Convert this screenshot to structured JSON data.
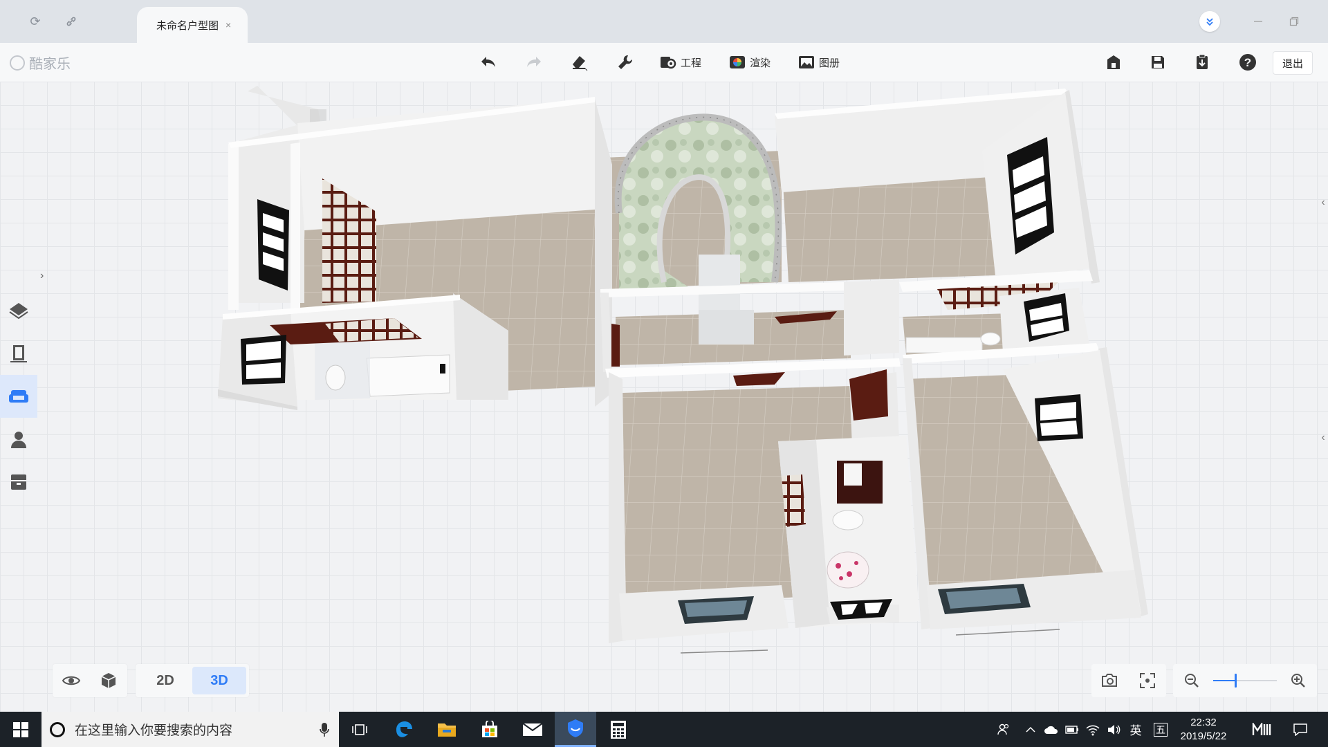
{
  "tabbar": {
    "tab_label": "未命名户型图",
    "tab_close": "×"
  },
  "toolbar": {
    "brand": "酷家乐",
    "project_label": "工程",
    "render_label": "渲染",
    "album_label": "图册",
    "exit_label": "退出"
  },
  "view": {
    "mode_2d": "2D",
    "mode_3d": "3D",
    "active_mode": "3D"
  },
  "zoom": {
    "level_fraction": 0.35
  },
  "taskbar": {
    "search_placeholder": "在这里输入你要搜索的内容",
    "ime_lang": "英",
    "ime_mode": "五",
    "time": "22:32",
    "date": "2019/5/22"
  },
  "colors": {
    "accent": "#2f7cf6",
    "floor_tile": "#bdb3a6",
    "wall": "#f4f4f4",
    "wood": "#5c1d12"
  }
}
